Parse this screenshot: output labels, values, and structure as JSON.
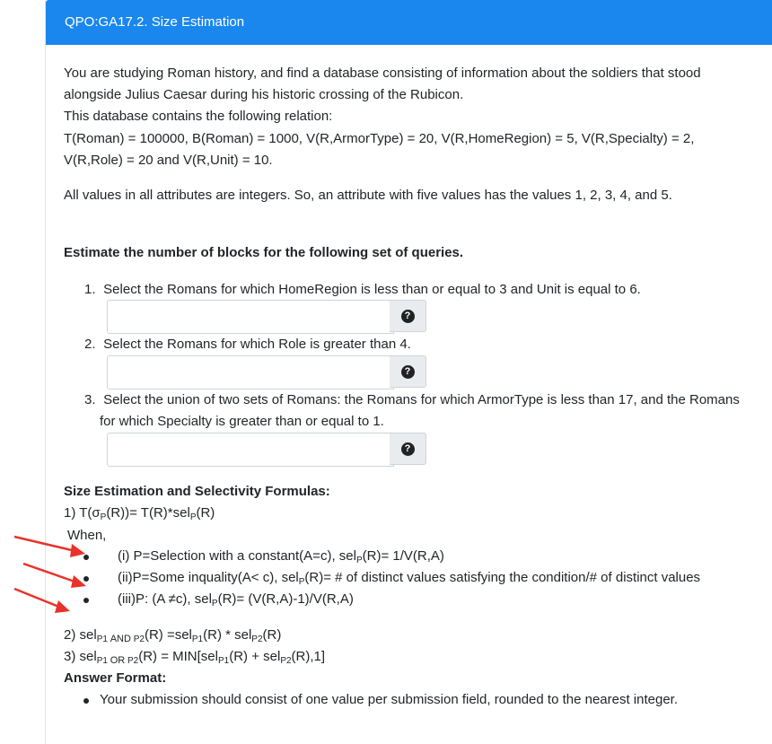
{
  "header": {
    "title": "QPO:GA17.2. Size Estimation"
  },
  "intro": {
    "line1": "You are studying Roman history, and find a database consisting of information about the soldiers that stood",
    "line2": "alongside Julius Caesar during his historic crossing of the Rubicon.",
    "line3": "This database contains the following relation:",
    "line4": "T(Roman) = 100000, B(Roman) = 1000, V(R,ArmorType) = 20, V(R,HomeRegion) = 5, V(R,Specialty) = 2,",
    "line5": "V(R,Role) = 20 and V(R,Unit) = 10.",
    "line6": "All values in all attributes are integers. So, an attribute with five values has the values 1, 2, 3, 4, and 5."
  },
  "task": {
    "heading": "Estimate the number of blocks for the following set of queries."
  },
  "questions": [
    {
      "num": "1.",
      "text": "Select the Romans for which HomeRegion is less than or equal to 3 and Unit is equal to 6."
    },
    {
      "num": "2.",
      "text": "Select the Romans for which Role is greater than 4."
    },
    {
      "num": "3.",
      "text": "Select the union of two sets of Romans: the Romans for which ArmorType is less than 17, and the Romans",
      "text2": "for which Specialty is greater than or equal to 1."
    }
  ],
  "answers": {
    "a1": "",
    "a2": "",
    "a3": ""
  },
  "help_icon": "question-circle-icon",
  "formulas": {
    "heading": "Size Estimation and Selectivity Formulas:",
    "f1": "1) T(σP(R))= T(R)*selP(R)",
    "when": "When,",
    "bullets": [
      "(i) P=Selection with a constant(A=c), selP(R)= 1/V(R,A)",
      "(ii)P=Some inquality(A< c), selP(R)= # of distinct values satisfying the condition/# of distinct values",
      "(iii)P: (A ≠c), selP(R)= (V(R,A)-1)/V(R,A)"
    ],
    "f2": "2) selP1 AND P2(R) =selP1(R) * selP2(R)",
    "f3": "3) selP1 OR P2(R) = MIN[selP1(R) + selP2(R),1]"
  },
  "answer_format": {
    "heading": "Answer Format:",
    "bullet": "Your submission should consist of one value per submission field, rounded to the nearest integer."
  },
  "colors": {
    "header": "#1a87ee",
    "arrow": "#e8322c",
    "text": "#212529"
  }
}
